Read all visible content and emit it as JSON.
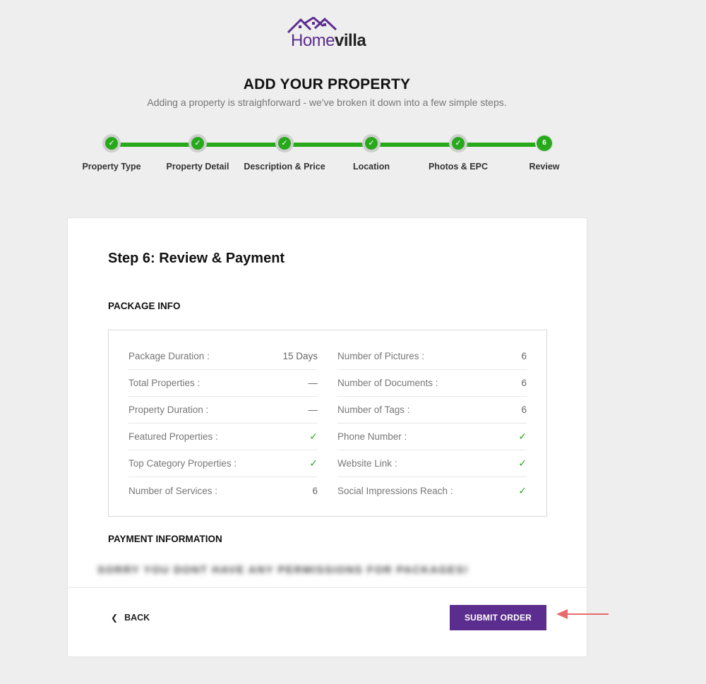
{
  "brand": {
    "logo_part1": "Home",
    "logo_part2": "villa",
    "accent_color": "#5b2d8e",
    "success_color": "#28a91c"
  },
  "header": {
    "title": "ADD YOUR PROPERTY",
    "subtitle": "Adding a property is straighforward - we've broken it down into a few simple steps."
  },
  "stepper": {
    "steps": [
      {
        "label": "Property Type",
        "status": "done",
        "marker": "✓"
      },
      {
        "label": "Property Detail",
        "status": "done",
        "marker": "✓"
      },
      {
        "label": "Description & Price",
        "status": "done",
        "marker": "✓"
      },
      {
        "label": "Location",
        "status": "done",
        "marker": "✓"
      },
      {
        "label": "Photos & EPC",
        "status": "done",
        "marker": "✓"
      },
      {
        "label": "Review",
        "status": "current",
        "marker": "6"
      }
    ]
  },
  "card": {
    "title": "Step 6: Review & Payment",
    "package_section_title": "PACKAGE INFO",
    "package_left": [
      {
        "label": "Package Duration :",
        "value": "15 Days"
      },
      {
        "label": "Total Properties :",
        "value": "—"
      },
      {
        "label": "Property Duration :",
        "value": "—"
      },
      {
        "label": "Featured Properties :",
        "value": "✓"
      },
      {
        "label": "Top Category Properties :",
        "value": "✓"
      },
      {
        "label": "Number of Services :",
        "value": "6"
      }
    ],
    "package_right": [
      {
        "label": "Number of Pictures :",
        "value": "6"
      },
      {
        "label": "Number of Documents :",
        "value": "6"
      },
      {
        "label": "Number of Tags :",
        "value": "6"
      },
      {
        "label": "Phone Number :",
        "value": "✓"
      },
      {
        "label": "Website Link :",
        "value": "✓"
      },
      {
        "label": "Social Impressions Reach :",
        "value": "✓"
      }
    ],
    "payment_section_title": "PAYMENT INFORMATION",
    "payment_message": "SORRY YOU DONT HAVE ANY PERMISSIONS FOR PACKAGES!",
    "back_label": "BACK",
    "submit_label": "SUBMIT ORDER"
  }
}
